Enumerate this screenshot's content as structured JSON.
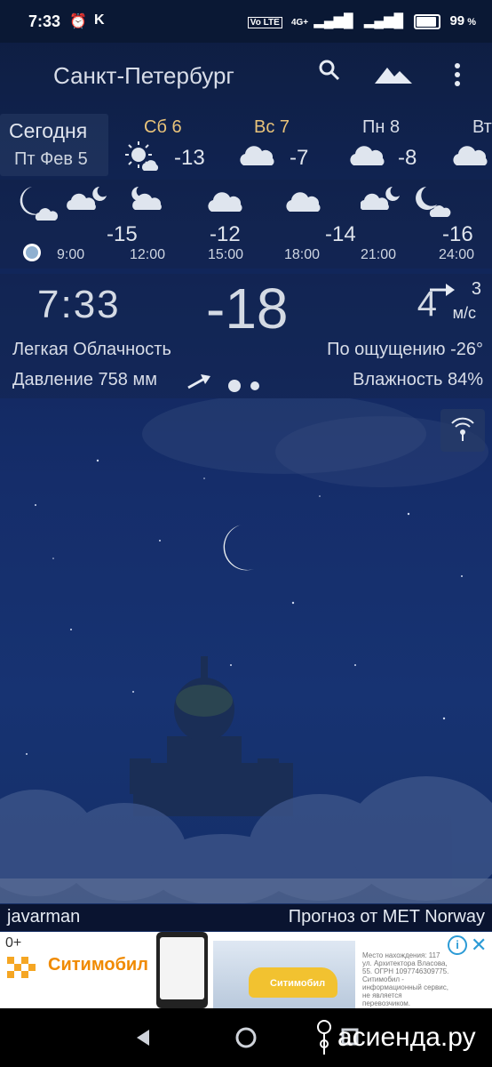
{
  "status": {
    "time": "7:33",
    "extra": "K",
    "battery": "99",
    "network": "4G+",
    "battery_level": 0.99
  },
  "header": {
    "city": "Санкт-Петербург"
  },
  "today": {
    "label": "Сегодня",
    "date": "Пт Фев 5"
  },
  "days": [
    {
      "label": "Сб 6",
      "temp": "-13",
      "icon": "sun-cloud-icon"
    },
    {
      "label": "Вс 7",
      "temp": "-7",
      "icon": "cloud-icon"
    },
    {
      "label": "Пн 8",
      "temp": "-8",
      "icon": "cloud-icon"
    },
    {
      "label": "Вт",
      "temp": "",
      "icon": "cloud-icon"
    }
  ],
  "hourly": [
    {
      "time": "9:00",
      "temp": ""
    },
    {
      "time": "12:00",
      "temp": "-15"
    },
    {
      "time": "15:00",
      "temp": "-12"
    },
    {
      "time": "18:00",
      "temp": ""
    },
    {
      "time": "21:00",
      "temp": "-14"
    },
    {
      "time": "24:00",
      "temp": "-16"
    }
  ],
  "current": {
    "time": "7:33",
    "temp": "-18",
    "wind_speed": "4",
    "wind_dir_value": "3",
    "wind_unit": "м/с",
    "condition": "Легкая Облачность",
    "feels_like": "По ощущению -26°",
    "pressure": "Давление 758 мм",
    "humidity": "Влажность 84%"
  },
  "footer": {
    "author": "javarman",
    "source": "Прогноз от MET Norway"
  },
  "ad": {
    "age": "0+",
    "brand": "Ситимобил",
    "fine_print": "Место нахождения: 117 ул. Архитектора Власова, 55. ОГРН 1097746309775. Ситимобил - информационный сервис, не является перевозчиком.",
    "car_text": "Ситимобил"
  },
  "watermark": "асиенда.ру",
  "colors": {
    "accent_day": "#e9c37a",
    "sky_top": "#0e1d3f",
    "sky_mid": "#173372"
  }
}
